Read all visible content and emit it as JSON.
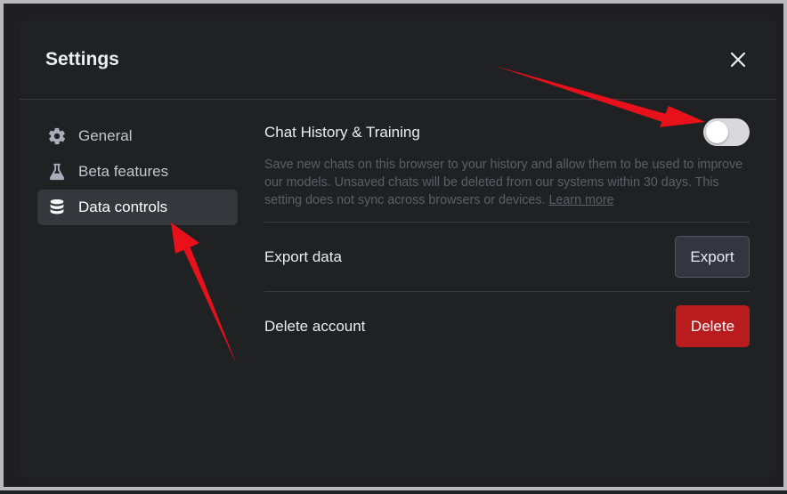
{
  "modal": {
    "title": "Settings"
  },
  "sidebar": {
    "items": [
      {
        "label": "General",
        "icon": "gear-icon",
        "active": false
      },
      {
        "label": "Beta features",
        "icon": "flask-icon",
        "active": false
      },
      {
        "label": "Data controls",
        "icon": "database-icon",
        "active": true
      }
    ]
  },
  "data_controls": {
    "chat_history": {
      "title": "Chat History & Training",
      "description": "Save new chats on this browser to your history and allow them to be used to improve our models. Unsaved chats will be deleted from our systems within 30 days. This setting does not sync across browsers or devices.",
      "learn_more": "Learn more",
      "toggle_on": false
    },
    "export": {
      "label": "Export data",
      "button": "Export"
    },
    "delete": {
      "label": "Delete account",
      "button": "Delete"
    }
  },
  "colors": {
    "background": "#202123",
    "active_item": "#36373d",
    "delete": "#b91c1c",
    "annotation_arrow": "#e8101a"
  }
}
